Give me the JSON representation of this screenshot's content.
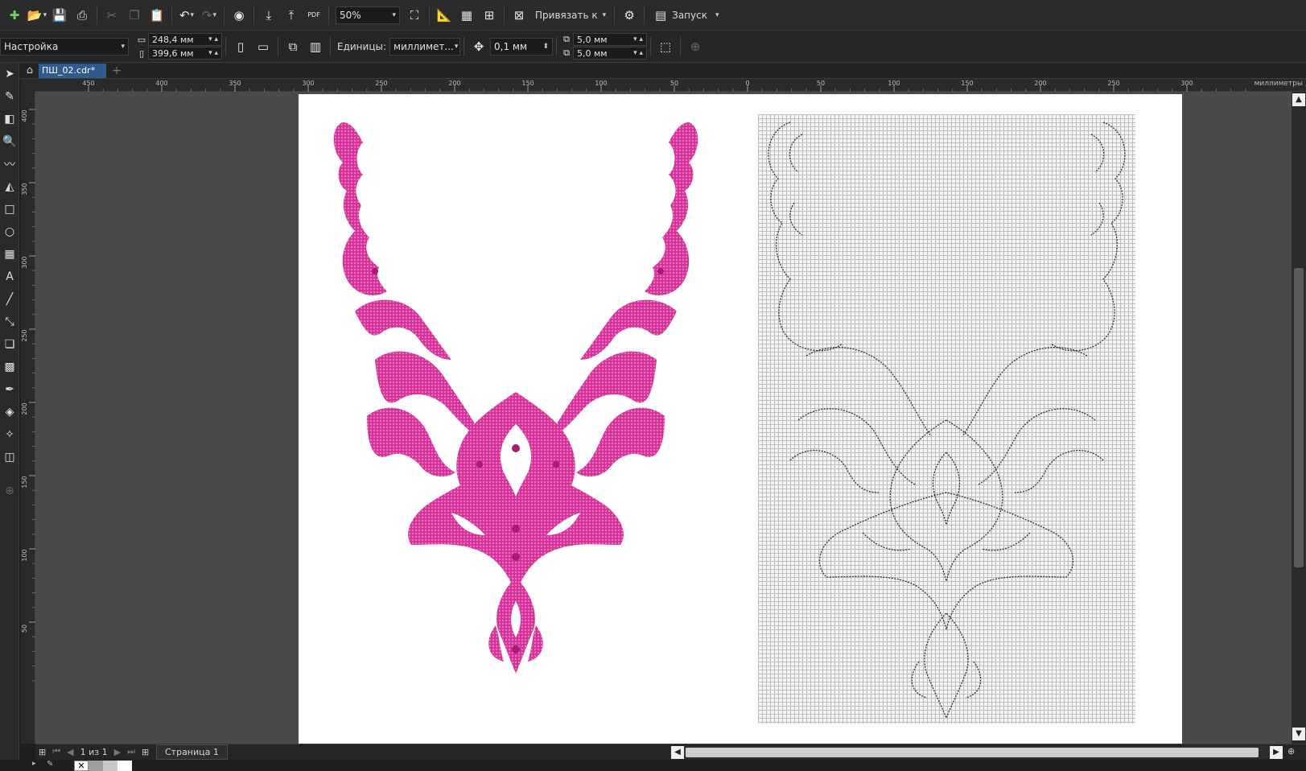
{
  "toolbar": {
    "zoom_value": "50%",
    "snap_label": "Привязать к",
    "launch_label": "Запуск",
    "pdf_label": "PDF"
  },
  "property_bar": {
    "preset_value": "Настройка",
    "width_value": "248,4 мм",
    "height_value": "399,6 мм",
    "units_label": "Единицы:",
    "units_value": "миллимет...",
    "nudge_value": "0,1 мм",
    "dup_x_value": "5,0 мм",
    "dup_y_value": "5,0 мм"
  },
  "document": {
    "tab_label": "ПШ_02.cdr*"
  },
  "ruler": {
    "h_ticks": [
      "450",
      "400",
      "350",
      "300",
      "250",
      "200",
      "150",
      "100",
      "50",
      "0",
      "50",
      "100",
      "150",
      "200",
      "250",
      "300"
    ],
    "units": "миллиметры",
    "v_ticks": [
      "400",
      "350",
      "300",
      "250",
      "200",
      "150",
      "100",
      "50"
    ]
  },
  "status": {
    "page_counter": "1 из 1",
    "page_tab": "Страница 1"
  },
  "colors": {
    "embroidery_pink": "#d6339a",
    "accent_blue": "#2f5b8f",
    "canvas_bg": "#4a4a4a"
  }
}
